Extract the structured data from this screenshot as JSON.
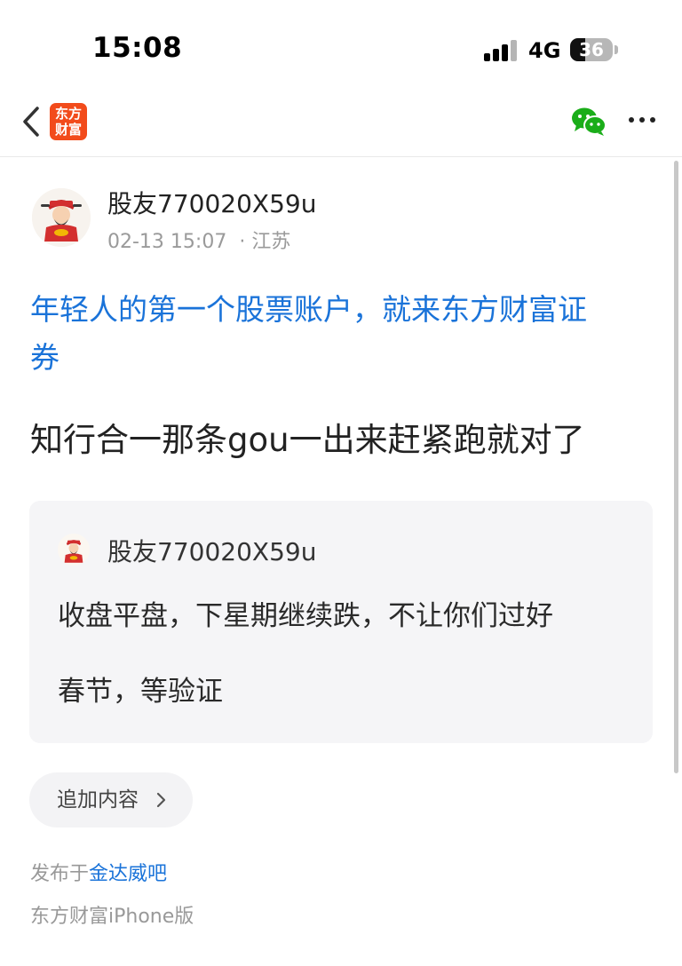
{
  "status_bar": {
    "time": "15:08",
    "network": "4G",
    "battery": "36",
    "battery_level_percent": 36
  },
  "nav": {
    "back_icon": "chevron-left-icon",
    "logo_lines": [
      "东方",
      "财富"
    ],
    "share_icon": "wechat-icon",
    "more_icon": "more-icon"
  },
  "post": {
    "author": "股友770020X59u",
    "time": "02-13 15:07",
    "location": "· 江苏",
    "title_lines": [
      "年轻人的第一个股票账户，就来东方财富证",
      "券"
    ],
    "body": "知行合一那条gou一出来赶紧跑就对了"
  },
  "quote": {
    "author": "股友770020X59u",
    "lines": [
      "收盘平盘，下星期继续跌，不让你们过好",
      "春节，等验证"
    ]
  },
  "append_button": {
    "label": "追加内容",
    "icon": "chevron-right-icon"
  },
  "footer": {
    "published_prefix": "发布于",
    "bar_name": "金达威吧",
    "client": "东方财富iPhone版"
  },
  "colors": {
    "link": "#1a73d9",
    "logo": "#f24b1b",
    "wechat": "#1aad19",
    "card_bg": "#f5f5f7"
  }
}
